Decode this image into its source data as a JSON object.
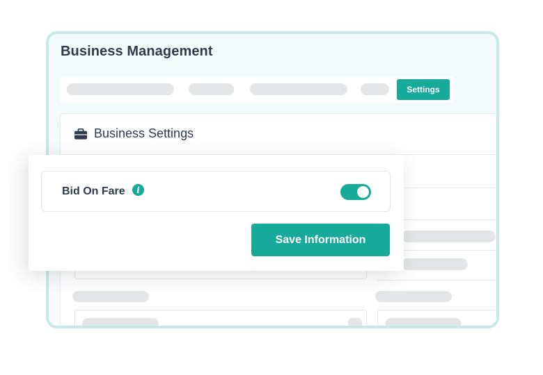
{
  "header": {
    "title": "Business Management"
  },
  "tabs": {
    "active_label": "Settings"
  },
  "card": {
    "title": "Business Settings",
    "icon": "briefcase-icon"
  },
  "overlay": {
    "toggle_label": "Bid On Fare",
    "toggle_on": true,
    "info_icon_glyph": "i",
    "save_label": "Save Information"
  },
  "colors": {
    "accent": "#17a99a",
    "window_border": "#c7e9e6",
    "text_dark": "#2f3b4c",
    "skeleton": "#e3e5e7"
  }
}
